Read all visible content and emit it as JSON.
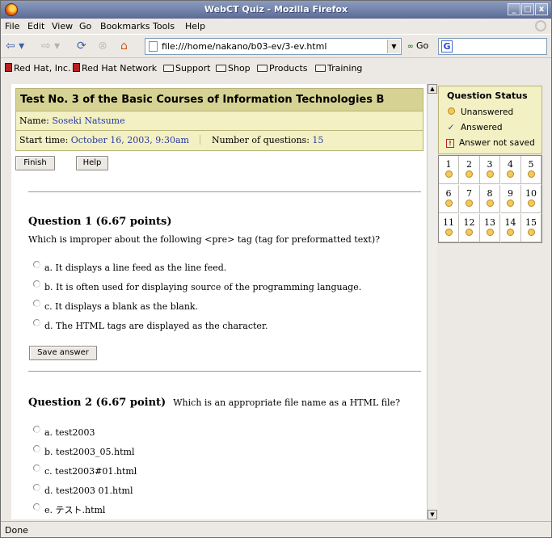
{
  "window": {
    "title": "WebCT Quiz - Mozilla Firefox",
    "controls": [
      "_",
      "□",
      "x"
    ]
  },
  "menu": [
    "File",
    "Edit",
    "View",
    "Go",
    "Bookmarks",
    "Tools",
    "Help"
  ],
  "nav": {
    "url": "file:///home/nakano/b03-ev/3-ev.html",
    "go_label": "Go",
    "search_placeholder": ""
  },
  "bookmarks": [
    {
      "label": "Red Hat, Inc.",
      "icon": "redhat-icon"
    },
    {
      "label": "Red Hat Network",
      "icon": "redhat-icon"
    },
    {
      "label": "Support",
      "icon": "folder-icon"
    },
    {
      "label": "Shop",
      "icon": "folder-icon"
    },
    {
      "label": "Products",
      "icon": "folder-icon"
    },
    {
      "label": "Training",
      "icon": "folder-icon"
    }
  ],
  "quiz": {
    "title": "Test No. 3 of the Basic Courses of Information Technologies B",
    "name_label": "Name:",
    "name_value": "Soseki Natsume",
    "start_label": "Start time:",
    "start_value": "October 16, 2003, 9:30am",
    "count_label": "Number of questions:",
    "count_value": "15",
    "finish_label": "Finish",
    "help_label": "Help"
  },
  "questions": [
    {
      "heading": "Question 1 (6.67 points)",
      "text": "Which is improper about the following <pre> tag (tag for preformatted text)?",
      "options": [
        "a. It displays a line feed as the line feed.",
        "b. It is often used for displaying source of the programming language.",
        "c. It displays a blank as the blank.",
        "d. The HTML tags are displayed as the character."
      ],
      "save_label": "Save answer"
    },
    {
      "heading": "Question 2 (6.67 point)",
      "text": "Which is an appropriate file name as a HTML file?",
      "options": [
        "a. test2003",
        "b. test2003_05.html",
        "c. test2003#01.html",
        "d. test2003 01.html",
        "e. テスト.html"
      ]
    }
  ],
  "status_panel": {
    "title": "Question Status",
    "legend": [
      {
        "symbol": "○",
        "label": "Unanswered"
      },
      {
        "symbol": "✓",
        "label": "Answered"
      },
      {
        "symbol": "!",
        "label": "Answer not saved"
      }
    ],
    "numbers": [
      "1",
      "2",
      "3",
      "4",
      "5",
      "6",
      "7",
      "8",
      "9",
      "10",
      "11",
      "12",
      "13",
      "14",
      "15"
    ]
  },
  "statusbar": {
    "text": "Done"
  },
  "colors": {
    "accent": "#2a3aa0",
    "header_bg": "#d6d293",
    "panel_bg": "#f3f0c4",
    "unanswered": "#f6c85a"
  }
}
